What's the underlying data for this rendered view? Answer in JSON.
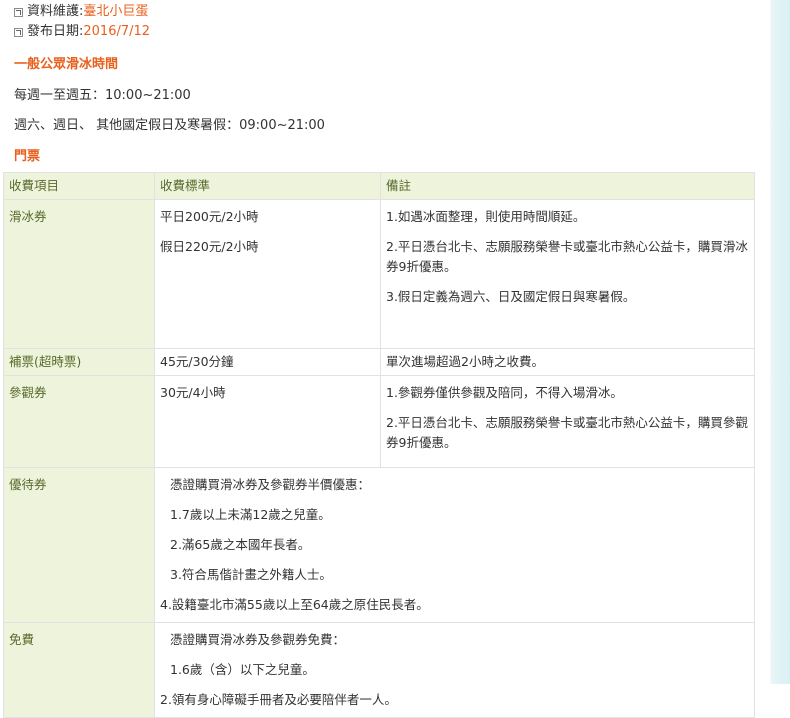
{
  "meta": {
    "maintainer_label": "資料維護:",
    "maintainer_value": "臺北小巨蛋",
    "publish_label": "發布日期:",
    "publish_value": "2016/7/12"
  },
  "public_skating": {
    "title": "一般公眾滑冰時間",
    "weekday": "每週一至週五：10:00~21:00",
    "weekend": "週六、週日、 其他國定假日及寒暑假：09:00~21:00"
  },
  "tickets": {
    "title": "門票",
    "headers": [
      "收費項目",
      "收費標準",
      "備註"
    ],
    "rows": [
      {
        "item": "滑冰券",
        "prices": [
          "平日200元/2小時",
          "假日220元/2小時"
        ],
        "notes": [
          "1.如遇冰面整理，則使用時間順延。",
          "2.平日憑台北卡、志願服務榮譽卡或臺北市熱心公益卡，購買滑冰券9折優惠。",
          "3.假日定義為週六、日及國定假日與寒暑假。"
        ]
      },
      {
        "item": "補票(超時票)",
        "price": "45元/30分鐘",
        "note": "單次進場超過2小時之收費。"
      },
      {
        "item": "參觀券",
        "price": "30元/4小時",
        "notes": [
          "1.參觀券僅供參觀及陪同，不得入場滑冰。",
          "2.平日憑台北卡、志願服務榮譽卡或臺北市熱心公益卡，購買參觀券9折優惠。"
        ]
      },
      {
        "item": "優待券",
        "lines": [
          "憑證購買滑冰券及參觀券半價優惠：",
          "1.7歲以上未滿12歲之兒童。",
          "2.滿65歲之本國年長者。",
          "3.符合馬偕計畫之外籍人士。",
          "4.設籍臺北市滿55歲以上至64歲之原住民長者。"
        ]
      },
      {
        "item": "免費",
        "lines": [
          "憑證購買滑冰券及參觀券免費：",
          "1.6歲（含）以下之兒童。",
          "2.領有身心障礙手冊者及必要陪伴者一人。"
        ]
      }
    ]
  }
}
